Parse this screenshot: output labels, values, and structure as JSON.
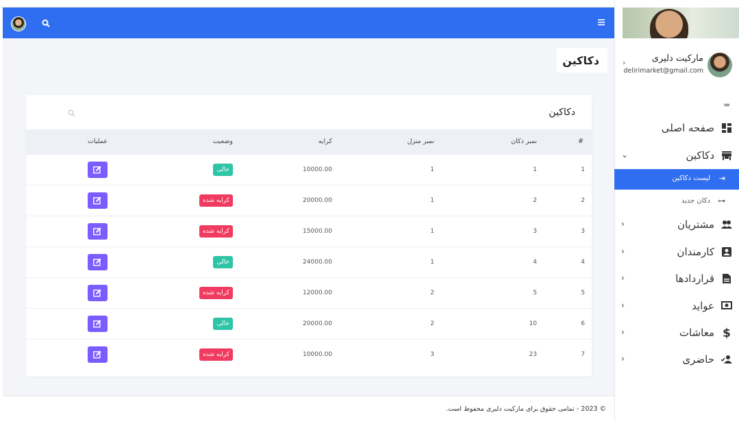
{
  "topbar": {
    "search_icon": "search-icon",
    "menu_icon": "hamburger-icon"
  },
  "sidebar": {
    "profile": {
      "name": "مارکیت دلیری",
      "email": "delirimarket@gmail.com"
    },
    "items": [
      {
        "label": "صفحه اصلی",
        "icon": "dashboard-icon"
      },
      {
        "label": "دکاکین",
        "icon": "store-icon",
        "expanded": true
      },
      {
        "label": "مشتریان",
        "icon": "users-icon"
      },
      {
        "label": "کارمندان",
        "icon": "id-card-icon"
      },
      {
        "label": "قراردادها",
        "icon": "document-icon"
      },
      {
        "label": "عواید",
        "icon": "money-icon"
      },
      {
        "label": "معاشات",
        "icon": "dollar-icon"
      },
      {
        "label": "حاضری",
        "icon": "user-check-icon"
      }
    ],
    "sub_items": [
      {
        "label": "لیست دکاکین",
        "active": true
      },
      {
        "label": "دکان جدید",
        "active": false
      }
    ]
  },
  "page": {
    "title": "دکاکین"
  },
  "card": {
    "title": "دکاکین",
    "headers": [
      "#",
      "نمبر دکان",
      "نمبر منزل",
      "کرایه",
      "وضعیت",
      "عملیات"
    ],
    "rows": [
      {
        "n": "1",
        "shop": "1",
        "floor": "1",
        "rent": "10000.00",
        "status": "خالی",
        "status_type": "empty"
      },
      {
        "n": "2",
        "shop": "2",
        "floor": "1",
        "rent": "20000.00",
        "status": "کرایه شده",
        "status_type": "rented"
      },
      {
        "n": "3",
        "shop": "3",
        "floor": "1",
        "rent": "15000.00",
        "status": "کرایه شده",
        "status_type": "rented"
      },
      {
        "n": "4",
        "shop": "4",
        "floor": "1",
        "rent": "24000.00",
        "status": "خالی",
        "status_type": "empty"
      },
      {
        "n": "5",
        "shop": "5",
        "floor": "2",
        "rent": "12000.00",
        "status": "کرایه شده",
        "status_type": "rented"
      },
      {
        "n": "6",
        "shop": "10",
        "floor": "2",
        "rent": "20000.00",
        "status": "خالی",
        "status_type": "empty"
      },
      {
        "n": "7",
        "shop": "23",
        "floor": "3",
        "rent": "10000.00",
        "status": "کرایه شده",
        "status_type": "rented"
      }
    ]
  },
  "colors": {
    "primary": "#2f6ef0",
    "empty": "#2ec4a6",
    "rented": "#f03a5f",
    "edit": "#7b5cff"
  },
  "footer": {
    "text": "© 2023 - تمامی حقوق برای مارکیت دلیری محفوظ است."
  }
}
